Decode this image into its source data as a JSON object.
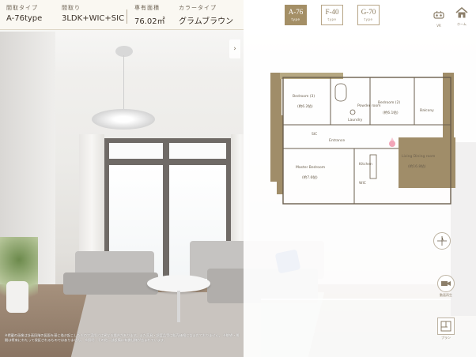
{
  "info": {
    "type_label": "間取タイプ",
    "type_value": "A-76type",
    "layout_label": "間取り",
    "layout_value": "3LDK+WIC+SIC",
    "area_label": "専有面積",
    "area_value": "76.02㎡",
    "color_label": "カラータイプ",
    "color_value": "グラムブラウン"
  },
  "collapse_icon": "chevron-right-icon",
  "types": [
    {
      "label": "A-76",
      "sub": "type",
      "active": true
    },
    {
      "label": "F-40",
      "sub": "type",
      "active": false
    },
    {
      "label": "G-70",
      "sub": "type",
      "active": false
    }
  ],
  "top_icons": {
    "vr_label": "VR",
    "home_label": "ホーム"
  },
  "floorplan": {
    "rooms": [
      "Bedroom (3)",
      "Bedroom (2)",
      "Master Bedroom",
      "Living Dining room",
      "Balcony",
      "Laundry",
      "Powder room",
      "Entrance",
      "Kitchen",
      "WIC",
      "SIC"
    ],
    "room_sizes": [
      "(約6.2帖)",
      "(約6.1帖)",
      "(約7.6帖)",
      "(約16.8帖)"
    ]
  },
  "side_buttons": {
    "video_label": "動画再生",
    "plan_label": "プラン"
  },
  "colors": {
    "accent": "#a48f66",
    "plan_wall": "#a08d69",
    "plan_balcony": "#b6a882"
  },
  "disclaimer": "※掲載の画像は計画段階の図面を基に描き起こしたもので実際とは異なる場合があります。また家具・調度品等は販売価格に含まれておりません。 ※眺望・景観は将来にわたって保証されるものではありません。 ※照明・その他一部設備は有償仕様が含まれています。"
}
